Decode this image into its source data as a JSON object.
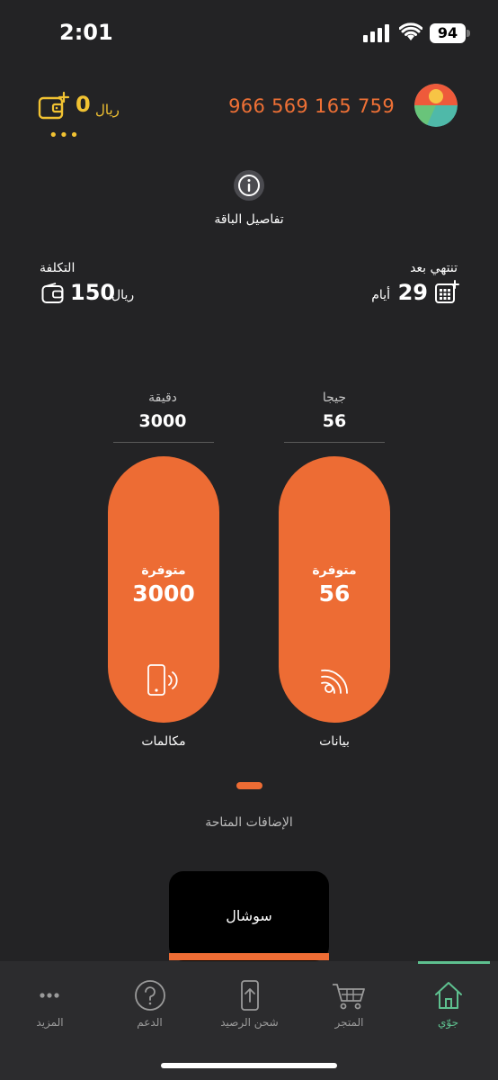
{
  "status_bar": {
    "time": "2:01",
    "battery": "94"
  },
  "header": {
    "phone_number": "966 569 165 759",
    "balance_value": "0",
    "balance_currency": "ريال",
    "balance_more": "•••"
  },
  "plan": {
    "details_label": "تفاصيل الباقة"
  },
  "expiry": {
    "label": "تنتهي بعد",
    "value": "29",
    "unit": "أيام"
  },
  "cost": {
    "label": "التكلفة",
    "value": "150",
    "currency": "ريال"
  },
  "data_usage": {
    "unit_label": "جيجا",
    "total": "56",
    "available_label": "متوفرة",
    "available_value": "56",
    "caption": "بيانات"
  },
  "calls_usage": {
    "unit_label": "دقيقة",
    "total": "3000",
    "available_label": "متوفرة",
    "available_value": "3000",
    "caption": "مكالمات"
  },
  "addons": {
    "title": "الإضافات المتاحة",
    "cards": [
      {
        "title": "سوشال"
      }
    ]
  },
  "bottom_nav": {
    "items": [
      {
        "label": "جوّي",
        "icon": "home-icon",
        "active": true
      },
      {
        "label": "المتجر",
        "icon": "cart-icon",
        "active": false
      },
      {
        "label": "شحن الرصيد",
        "icon": "recharge-icon",
        "active": false
      },
      {
        "label": "الدعم",
        "icon": "help-icon",
        "active": false
      },
      {
        "label": "المزيد",
        "icon": "more-icon",
        "active": false
      }
    ]
  },
  "colors": {
    "background": "#232325",
    "accent_orange": "#ed6c34",
    "balance_yellow": "#f1c232",
    "active_green": "#5ec08f"
  }
}
